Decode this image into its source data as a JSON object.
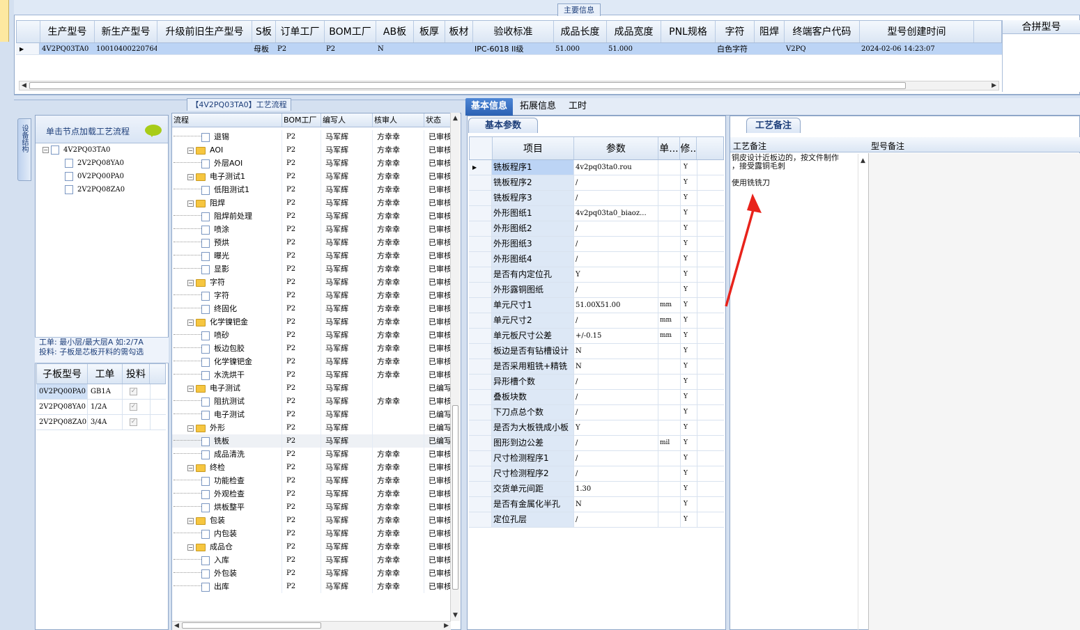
{
  "main_tab_label": "主要信息",
  "main_grid": {
    "headers": [
      "生产型号",
      "新生产型号",
      "升级前旧生产型号",
      "S板",
      "订单工厂",
      "BOM工厂",
      "AB板",
      "板厚",
      "板材",
      "验收标准",
      "成品长度",
      "成品宽度",
      "PNL规格",
      "字符",
      "阻焊",
      "终端客户代码",
      "型号创建时间"
    ],
    "row": [
      "4V2PQ03TA0",
      "10010400220764",
      "",
      "母板",
      "P2",
      "P2",
      "N",
      "",
      "",
      "IPC-6018 II级",
      "51.000",
      "51.000",
      "",
      "白色字符",
      "",
      "V2PQ",
      "2024-02-06 14:23:07"
    ],
    "merge_header": "合拼型号"
  },
  "left_panel": {
    "vtab_label": "设备结构",
    "head_label": "单击节点加载工艺流程",
    "tree": {
      "root": "4V2PQ03TA0",
      "children": [
        "2V2PQ08YA0",
        "0V2PQ00PA0",
        "2V2PQ08ZA0"
      ]
    },
    "info_line1": "工单: 最小层/最大层A 如:2/7A",
    "info_line2": "投料: 子板是芯板开料的需勾选",
    "sub_grid": {
      "headers": [
        "子板型号",
        "工单",
        "投料"
      ],
      "rows": [
        {
          "model": "0V2PQ00PA0",
          "order": "GB1A",
          "check": "✓"
        },
        {
          "model": "2V2PQ08YA0",
          "order": "1/2A",
          "check": "✓"
        },
        {
          "model": "2V2PQ08ZA0",
          "order": "3/4A",
          "check": "✓"
        }
      ]
    }
  },
  "process": {
    "title": "【4V2PQ03TA0】工艺流程",
    "headers": [
      "流程",
      "BOM工厂",
      "编写人",
      "核审人",
      "状态"
    ],
    "rows": [
      {
        "level": 2,
        "type": "doc",
        "name": "退锡",
        "bom": "P2",
        "writer": "马军辉",
        "reviewer": "方幸幸",
        "status": "已审核"
      },
      {
        "level": 1,
        "type": "folder",
        "name": "AOI",
        "bom": "P2",
        "writer": "马军辉",
        "reviewer": "方幸幸",
        "status": "已审核"
      },
      {
        "level": 2,
        "type": "doc",
        "name": "外层AOI",
        "bom": "P2",
        "writer": "马军辉",
        "reviewer": "方幸幸",
        "status": "已审核"
      },
      {
        "level": 1,
        "type": "folder",
        "name": "电子测试1",
        "bom": "P2",
        "writer": "马军辉",
        "reviewer": "方幸幸",
        "status": "已审核"
      },
      {
        "level": 2,
        "type": "doc",
        "name": "低阻测试1",
        "bom": "P2",
        "writer": "马军辉",
        "reviewer": "方幸幸",
        "status": "已审核"
      },
      {
        "level": 1,
        "type": "folder",
        "name": "阻焊",
        "bom": "P2",
        "writer": "马军辉",
        "reviewer": "方幸幸",
        "status": "已审核"
      },
      {
        "level": 2,
        "type": "doc",
        "name": "阻焊前处理",
        "bom": "P2",
        "writer": "马军辉",
        "reviewer": "方幸幸",
        "status": "已审核"
      },
      {
        "level": 2,
        "type": "doc",
        "name": "喷涂",
        "bom": "P2",
        "writer": "马军辉",
        "reviewer": "方幸幸",
        "status": "已审核"
      },
      {
        "level": 2,
        "type": "doc",
        "name": "预烘",
        "bom": "P2",
        "writer": "马军辉",
        "reviewer": "方幸幸",
        "status": "已审核"
      },
      {
        "level": 2,
        "type": "doc",
        "name": "曝光",
        "bom": "P2",
        "writer": "马军辉",
        "reviewer": "方幸幸",
        "status": "已审核"
      },
      {
        "level": 2,
        "type": "doc",
        "name": "显影",
        "bom": "P2",
        "writer": "马军辉",
        "reviewer": "方幸幸",
        "status": "已审核"
      },
      {
        "level": 1,
        "type": "folder",
        "name": "字符",
        "bom": "P2",
        "writer": "马军辉",
        "reviewer": "方幸幸",
        "status": "已审核"
      },
      {
        "level": 2,
        "type": "doc",
        "name": "字符",
        "bom": "P2",
        "writer": "马军辉",
        "reviewer": "方幸幸",
        "status": "已审核"
      },
      {
        "level": 2,
        "type": "doc",
        "name": "终固化",
        "bom": "P2",
        "writer": "马军辉",
        "reviewer": "方幸幸",
        "status": "已审核"
      },
      {
        "level": 1,
        "type": "folder",
        "name": "化学镍钯金",
        "bom": "P2",
        "writer": "马军辉",
        "reviewer": "方幸幸",
        "status": "已审核"
      },
      {
        "level": 2,
        "type": "doc",
        "name": "喷砂",
        "bom": "P2",
        "writer": "马军辉",
        "reviewer": "方幸幸",
        "status": "已审核"
      },
      {
        "level": 2,
        "type": "doc",
        "name": "板边包胶",
        "bom": "P2",
        "writer": "马军辉",
        "reviewer": "方幸幸",
        "status": "已审核"
      },
      {
        "level": 2,
        "type": "doc",
        "name": "化学镍钯金",
        "bom": "P2",
        "writer": "马军辉",
        "reviewer": "方幸幸",
        "status": "已审核"
      },
      {
        "level": 2,
        "type": "doc",
        "name": "水洗烘干",
        "bom": "P2",
        "writer": "马军辉",
        "reviewer": "方幸幸",
        "status": "已审核"
      },
      {
        "level": 1,
        "type": "folder",
        "name": "电子测试",
        "bom": "P2",
        "writer": "马军辉",
        "reviewer": "",
        "status": "已编写"
      },
      {
        "level": 2,
        "type": "doc",
        "name": "阻抗测试",
        "bom": "P2",
        "writer": "马军辉",
        "reviewer": "方幸幸",
        "status": "已审核"
      },
      {
        "level": 2,
        "type": "doc",
        "name": "电子测试",
        "bom": "P2",
        "writer": "马军辉",
        "reviewer": "",
        "status": "已编写"
      },
      {
        "level": 1,
        "type": "folder",
        "name": "外形",
        "bom": "P2",
        "writer": "马军辉",
        "reviewer": "",
        "status": "已编写"
      },
      {
        "level": 2,
        "type": "doc",
        "name": "铣板",
        "bom": "P2",
        "writer": "马军辉",
        "reviewer": "",
        "status": "已编写",
        "selected": true
      },
      {
        "level": 2,
        "type": "doc",
        "name": "成品清洗",
        "bom": "P2",
        "writer": "马军辉",
        "reviewer": "方幸幸",
        "status": "已审核"
      },
      {
        "level": 1,
        "type": "folder",
        "name": "终检",
        "bom": "P2",
        "writer": "马军辉",
        "reviewer": "方幸幸",
        "status": "已审核"
      },
      {
        "level": 2,
        "type": "doc",
        "name": "功能检查",
        "bom": "P2",
        "writer": "马军辉",
        "reviewer": "方幸幸",
        "status": "已审核"
      },
      {
        "level": 2,
        "type": "doc",
        "name": "外观检查",
        "bom": "P2",
        "writer": "马军辉",
        "reviewer": "方幸幸",
        "status": "已审核"
      },
      {
        "level": 2,
        "type": "doc",
        "name": "烘板整平",
        "bom": "P2",
        "writer": "马军辉",
        "reviewer": "方幸幸",
        "status": "已审核"
      },
      {
        "level": 1,
        "type": "folder",
        "name": "包装",
        "bom": "P2",
        "writer": "马军辉",
        "reviewer": "方幸幸",
        "status": "已审核"
      },
      {
        "level": 2,
        "type": "doc",
        "name": "内包装",
        "bom": "P2",
        "writer": "马军辉",
        "reviewer": "方幸幸",
        "status": "已审核"
      },
      {
        "level": 1,
        "type": "folder",
        "name": "成品仓",
        "bom": "P2",
        "writer": "马军辉",
        "reviewer": "方幸幸",
        "status": "已审核"
      },
      {
        "level": 2,
        "type": "doc",
        "name": "入库",
        "bom": "P2",
        "writer": "马军辉",
        "reviewer": "方幸幸",
        "status": "已审核"
      },
      {
        "level": 2,
        "type": "doc",
        "name": "外包装",
        "bom": "P2",
        "writer": "马军辉",
        "reviewer": "方幸幸",
        "status": "已审核"
      },
      {
        "level": 2,
        "type": "doc",
        "name": "出库",
        "bom": "P2",
        "writer": "马军辉",
        "reviewer": "方幸幸",
        "status": "已审核"
      }
    ]
  },
  "right_tabs": [
    "基本信息",
    "拓展信息",
    "工时"
  ],
  "basic": {
    "subtab": "基本参数",
    "headers": [
      "项目",
      "参数",
      "单...",
      "修.."
    ],
    "rows": [
      {
        "item": "铣板程序1",
        "param": "4v2pq03ta0.rou",
        "unit": "",
        "mod": "Y"
      },
      {
        "item": "铣板程序2",
        "param": "/",
        "unit": "",
        "mod": "Y"
      },
      {
        "item": "铣板程序3",
        "param": "/",
        "unit": "",
        "mod": "Y"
      },
      {
        "item": "外形图纸1",
        "param": "4v2pq03ta0_biaoz...",
        "unit": "",
        "mod": "Y"
      },
      {
        "item": "外形图纸2",
        "param": "/",
        "unit": "",
        "mod": "Y"
      },
      {
        "item": "外形图纸3",
        "param": "/",
        "unit": "",
        "mod": "Y"
      },
      {
        "item": "外形图纸4",
        "param": "/",
        "unit": "",
        "mod": "Y"
      },
      {
        "item": "是否有内定位孔",
        "param": "Y",
        "unit": "",
        "mod": "Y"
      },
      {
        "item": "外形露铜图纸",
        "param": "/",
        "unit": "",
        "mod": "Y"
      },
      {
        "item": "单元尺寸1",
        "param": "51.00X51.00",
        "unit": "mm",
        "mod": "Y"
      },
      {
        "item": "单元尺寸2",
        "param": "/",
        "unit": "mm",
        "mod": "Y"
      },
      {
        "item": "单元板尺寸公差",
        "param": "+/-0.15",
        "unit": "mm",
        "mod": "Y"
      },
      {
        "item": "板边是否有钻槽设计",
        "param": "N",
        "unit": "",
        "mod": "Y"
      },
      {
        "item": "是否采用粗铣+精铣",
        "param": "N",
        "unit": "",
        "mod": "Y"
      },
      {
        "item": "异形槽个数",
        "param": "/",
        "unit": "",
        "mod": "Y"
      },
      {
        "item": "叠板块数",
        "param": "/",
        "unit": "",
        "mod": "Y"
      },
      {
        "item": "下刀点总个数",
        "param": "/",
        "unit": "",
        "mod": "Y"
      },
      {
        "item": "是否为大板铣成小板",
        "param": "Y",
        "unit": "",
        "mod": "Y"
      },
      {
        "item": "图形到边公差",
        "param": "/",
        "unit": "mil",
        "mod": "Y"
      },
      {
        "item": "尺寸检测程序1",
        "param": "/",
        "unit": "",
        "mod": "Y"
      },
      {
        "item": "尺寸检测程序2",
        "param": "/",
        "unit": "",
        "mod": "Y"
      },
      {
        "item": "交货单元间距",
        "param": "1.30",
        "unit": "",
        "mod": "Y"
      },
      {
        "item": "是否有金属化半孔",
        "param": "N",
        "unit": "",
        "mod": "Y"
      },
      {
        "item": "定位孔层",
        "param": "/",
        "unit": "",
        "mod": "Y"
      }
    ]
  },
  "remarks": {
    "subtab": "工艺备注",
    "col_process": "工艺备注",
    "col_model": "型号备注",
    "line1": "铜皮设计近板边的，按文件制作",
    "line2": "，接受露铜毛刺",
    "line3": "使用铣铣刀"
  },
  "colors": {
    "accent": "#2b61b3",
    "selection": "#bcd4f5",
    "arrow": "#e8231b"
  }
}
